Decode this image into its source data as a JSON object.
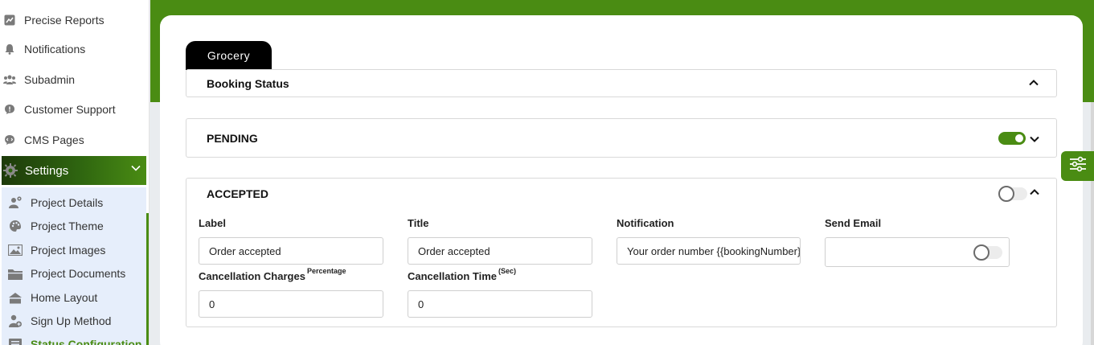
{
  "sidebar": {
    "items": [
      {
        "label": "Precise Reports",
        "icon": "report-icon"
      },
      {
        "label": "Notifications",
        "icon": "bell-icon"
      },
      {
        "label": "Subadmin",
        "icon": "users-icon"
      },
      {
        "label": "Customer Support",
        "icon": "chat-icon"
      },
      {
        "label": "CMS Pages",
        "icon": "code-chat-icon"
      }
    ],
    "settings": {
      "label": "Settings",
      "icon": "gear-icon"
    },
    "submenu": [
      {
        "label": "Project Details",
        "icon": "user-gear-icon"
      },
      {
        "label": "Project Theme",
        "icon": "palette-icon"
      },
      {
        "label": "Project Images",
        "icon": "image-icon"
      },
      {
        "label": "Project Documents",
        "icon": "folder-icon"
      },
      {
        "label": "Home Layout",
        "icon": "home-icon"
      },
      {
        "label": "Sign Up Method",
        "icon": "user-plus-icon"
      },
      {
        "label": "Status Configuration",
        "icon": "list-icon"
      }
    ]
  },
  "main": {
    "tab": "Grocery",
    "booking_status": {
      "title": "Booking Status"
    },
    "pending": {
      "title": "PENDING",
      "enabled": true
    },
    "accepted": {
      "title": "ACCEPTED",
      "enabled": false,
      "fields": {
        "label": {
          "label": "Label",
          "value": "Order accepted"
        },
        "title": {
          "label": "Title",
          "value": "Order accepted"
        },
        "notification": {
          "label": "Notification",
          "value": "Your order number {{bookingNumber}}"
        },
        "send_email": {
          "label": "Send Email",
          "enabled": false
        },
        "cancellation_charges": {
          "label": "Cancellation Charges",
          "unit": "Percentage",
          "value": "0"
        },
        "cancellation_time": {
          "label": "Cancellation Time",
          "unit": "(Sec)",
          "value": "0"
        }
      }
    }
  },
  "colors": {
    "accent": "#4a8c13",
    "tab_bg": "#000000",
    "submenu_bg": "#e6eefb"
  }
}
